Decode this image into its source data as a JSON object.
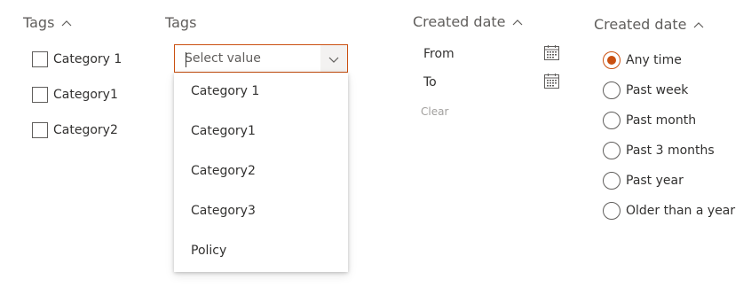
{
  "colors": {
    "accent": "#ca5010",
    "text": "#323130",
    "muted": "#605e5c",
    "disabled": "#a19f9d"
  },
  "tags_filter": {
    "title": "Tags",
    "icon": "chevron-up-icon",
    "options": [
      {
        "label": "Category 1",
        "checked": false
      },
      {
        "label": "Category1",
        "checked": false
      },
      {
        "label": "Category2",
        "checked": false
      }
    ]
  },
  "tags_dropdown": {
    "title": "Tags",
    "placeholder": "Select value",
    "value": "",
    "icon": "chevron-down-icon",
    "options": [
      "Category 1",
      "Category1",
      "Category2",
      "Category3",
      "Policy"
    ]
  },
  "created_range": {
    "title": "Created date",
    "icon": "chevron-up-icon",
    "from_label": "From",
    "to_label": "To",
    "clear_label": "Clear",
    "calendar_icon": "calendar-icon"
  },
  "created_preset": {
    "title": "Created date",
    "icon": "chevron-up-icon",
    "selected": "Any time",
    "options": [
      "Any time",
      "Past week",
      "Past month",
      "Past 3 months",
      "Past year",
      "Older than a year"
    ]
  }
}
